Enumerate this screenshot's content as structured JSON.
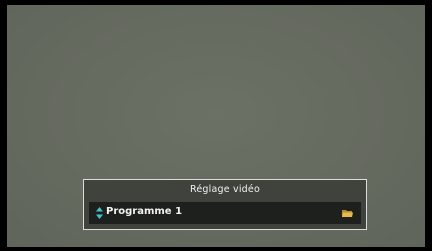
{
  "panel": {
    "title": "Réglage vidéo",
    "selected_option": "Programme 1",
    "icons": {
      "selector": "up-down-arrows-icon",
      "browse": "folder-icon"
    }
  },
  "colors": {
    "background": "#646a5e",
    "panel_border": "#dcdcdc",
    "row_background": "#1e201d",
    "arrow_accent": "#40c8c8",
    "folder_accent": "#e8b84a",
    "text": "#f2f2f2"
  }
}
